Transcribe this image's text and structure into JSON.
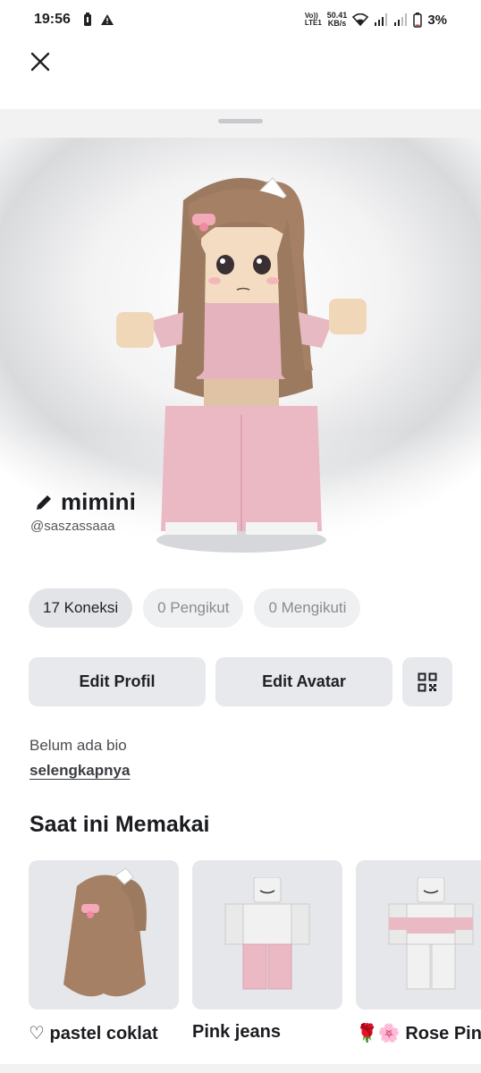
{
  "status_bar": {
    "time": "19:56",
    "volte_label": "Vo))",
    "lte_label": "LTE1",
    "net_speed_value": "50.41",
    "net_speed_unit": "KB/s",
    "battery_percent": "3%"
  },
  "icons": {
    "close": "close-icon",
    "edit": "pencil-icon",
    "qr": "qr-code-icon"
  },
  "profile": {
    "display_name": "mimini",
    "handle": "@saszassaaa"
  },
  "stats": {
    "connections": "17 Koneksi",
    "followers": "0 Pengikut",
    "following": "0 Mengikuti"
  },
  "actions": {
    "edit_profile": "Edit Profil",
    "edit_avatar": "Edit Avatar"
  },
  "bio": {
    "text": "Belum ada bio",
    "see_more": "selengkapnya"
  },
  "wearing": {
    "title": "Saat ini Memakai",
    "items": [
      {
        "label": "♡ pastel coklat"
      },
      {
        "label": "Pink jeans"
      },
      {
        "label": "🌹🌸 Rose Pink"
      }
    ]
  },
  "colors": {
    "chip_bg": "#eef0f2",
    "button_bg": "#e8e9ec",
    "text_primary": "#1b1c1f",
    "outfit_pink": "#e9b3bf",
    "hair_brown": "#a58065"
  }
}
